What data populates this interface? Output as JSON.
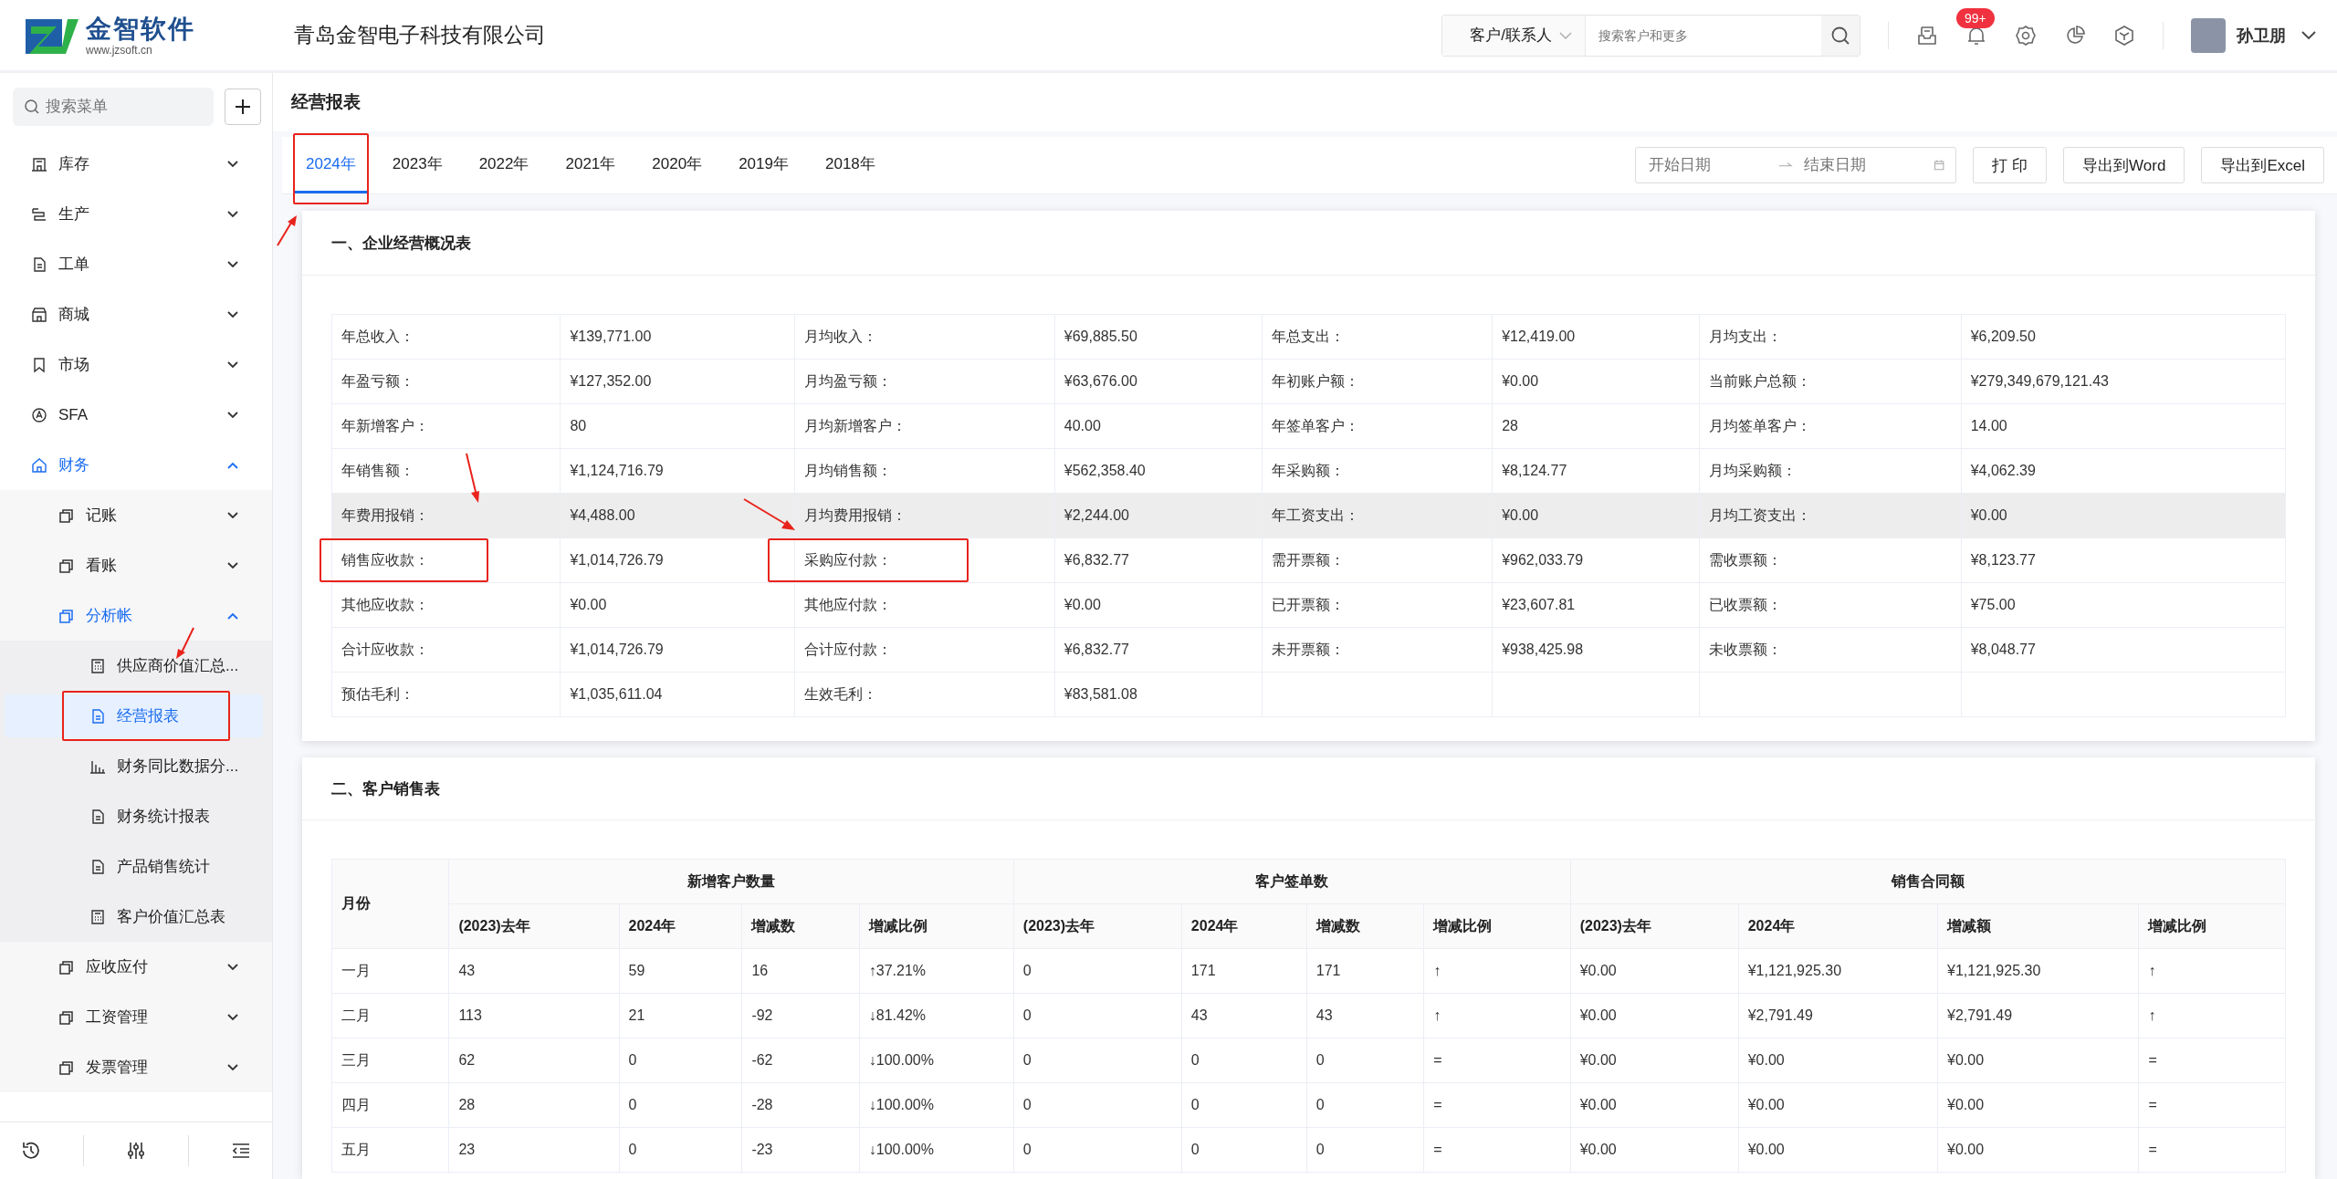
{
  "logo": {
    "name": "金智软件",
    "url": "www.jzsoft.cn"
  },
  "company": "青岛金智电子科技有限公司",
  "header": {
    "search_scope": "客户/联系人",
    "search": {
      "placeholder": "搜索客户和更多"
    },
    "notification_badge": "99+",
    "user": {
      "name": "孙卫朋"
    }
  },
  "sidebar": {
    "search": {
      "placeholder": "搜索菜单"
    },
    "items": [
      {
        "label": "库存",
        "selected": false,
        "expanded": false
      },
      {
        "label": "生产",
        "selected": false,
        "expanded": false
      },
      {
        "label": "工单",
        "selected": false,
        "expanded": false
      },
      {
        "label": "商城",
        "selected": false,
        "expanded": false
      },
      {
        "label": "市场",
        "selected": false,
        "expanded": false
      },
      {
        "label": "SFA",
        "selected": false,
        "expanded": false
      },
      {
        "label": "财务",
        "selected": true,
        "expanded": true,
        "children": [
          {
            "label": "记账",
            "selected": false,
            "expanded": false
          },
          {
            "label": "看账",
            "selected": false,
            "expanded": false
          },
          {
            "label": "分析帐",
            "selected": true,
            "expanded": true,
            "children": [
              {
                "label": "供应商价值汇总...",
                "selected": false,
                "highlighted": false
              },
              {
                "label": "经营报表",
                "selected": true,
                "highlighted": true
              },
              {
                "label": "财务同比数据分...",
                "selected": false,
                "highlighted": false
              },
              {
                "label": "财务统计报表",
                "selected": false,
                "highlighted": false
              },
              {
                "label": "产品销售统计",
                "selected": false,
                "highlighted": false
              },
              {
                "label": "客户价值汇总表",
                "selected": false,
                "highlighted": false
              }
            ]
          },
          {
            "label": "应收应付",
            "selected": false,
            "expanded": false
          },
          {
            "label": "工资管理",
            "selected": false,
            "expanded": false
          },
          {
            "label": "发票管理",
            "selected": false,
            "expanded": false
          }
        ]
      }
    ]
  },
  "page_title": "经营报表",
  "year_tabs": [
    {
      "label": "2024年",
      "selected": true,
      "highlighted": true
    },
    {
      "label": "2023年",
      "selected": false,
      "highlighted": false
    },
    {
      "label": "2022年",
      "selected": false,
      "highlighted": false
    },
    {
      "label": "2021年",
      "selected": false,
      "highlighted": false
    },
    {
      "label": "2020年",
      "selected": false,
      "highlighted": false
    },
    {
      "label": "2019年",
      "selected": false,
      "highlighted": false
    },
    {
      "label": "2018年",
      "selected": false,
      "highlighted": false
    }
  ],
  "date_range": {
    "start_placeholder": "开始日期",
    "end_placeholder": "结束日期"
  },
  "actions": [
    "打 印",
    "导出到Word",
    "导出到Excel"
  ],
  "overview": {
    "title": "一、企业经营概况表",
    "rows": [
      {
        "hovered": false,
        "pairs": [
          {
            "label": "年总收入：",
            "value": "¥139,771.00",
            "highlighted": false
          },
          {
            "label": "月均收入：",
            "value": "¥69,885.50",
            "highlighted": false
          },
          {
            "label": "年总支出：",
            "value": "¥12,419.00",
            "highlighted": false
          },
          {
            "label": "月均支出：",
            "value": "¥6,209.50",
            "highlighted": false
          }
        ]
      },
      {
        "hovered": false,
        "pairs": [
          {
            "label": "年盈亏额：",
            "value": "¥127,352.00",
            "highlighted": false
          },
          {
            "label": "月均盈亏额：",
            "value": "¥63,676.00",
            "highlighted": false
          },
          {
            "label": "年初账户额：",
            "value": "¥0.00",
            "highlighted": false
          },
          {
            "label": "当前账户总额：",
            "value": "¥279,349,679,121.43",
            "highlighted": false
          }
        ]
      },
      {
        "hovered": false,
        "pairs": [
          {
            "label": "年新增客户：",
            "value": "80",
            "highlighted": false
          },
          {
            "label": "月均新增客户：",
            "value": "40.00",
            "highlighted": false
          },
          {
            "label": "年签单客户：",
            "value": "28",
            "highlighted": false
          },
          {
            "label": "月均签单客户：",
            "value": "14.00",
            "highlighted": false
          }
        ]
      },
      {
        "hovered": false,
        "pairs": [
          {
            "label": "年销售额：",
            "value": "¥1,124,716.79",
            "highlighted": false
          },
          {
            "label": "月均销售额：",
            "value": "¥562,358.40",
            "highlighted": false
          },
          {
            "label": "年采购额：",
            "value": "¥8,124.77",
            "highlighted": false
          },
          {
            "label": "月均采购额：",
            "value": "¥4,062.39",
            "highlighted": false
          }
        ]
      },
      {
        "hovered": true,
        "pairs": [
          {
            "label": "年费用报销：",
            "value": "¥4,488.00",
            "highlighted": false
          },
          {
            "label": "月均费用报销：",
            "value": "¥2,244.00",
            "highlighted": false
          },
          {
            "label": "年工资支出：",
            "value": "¥0.00",
            "highlighted": false
          },
          {
            "label": "月均工资支出：",
            "value": "¥0.00",
            "highlighted": false
          }
        ]
      },
      {
        "hovered": false,
        "pairs": [
          {
            "label": "销售应收款：",
            "value": "¥1,014,726.79",
            "highlighted": true
          },
          {
            "label": "采购应付款：",
            "value": "¥6,832.77",
            "highlighted": true
          },
          {
            "label": "需开票额：",
            "value": "¥962,033.79",
            "highlighted": false
          },
          {
            "label": "需收票额：",
            "value": "¥8,123.77",
            "highlighted": false
          }
        ]
      },
      {
        "hovered": false,
        "pairs": [
          {
            "label": "其他应收款：",
            "value": "¥0.00",
            "highlighted": false
          },
          {
            "label": "其他应付款：",
            "value": "¥0.00",
            "highlighted": false
          },
          {
            "label": "已开票额：",
            "value": "¥23,607.81",
            "highlighted": false
          },
          {
            "label": "已收票额：",
            "value": "¥75.00",
            "highlighted": false
          }
        ]
      },
      {
        "hovered": false,
        "pairs": [
          {
            "label": "合计应收款：",
            "value": "¥1,014,726.79",
            "highlighted": false
          },
          {
            "label": "合计应付款：",
            "value": "¥6,832.77",
            "highlighted": false
          },
          {
            "label": "未开票额：",
            "value": "¥938,425.98",
            "highlighted": false
          },
          {
            "label": "未收票额：",
            "value": "¥8,048.77",
            "highlighted": false
          }
        ]
      },
      {
        "hovered": false,
        "pairs": [
          {
            "label": "预估毛利：",
            "value": "¥1,035,611.04",
            "highlighted": false
          },
          {
            "label": "生效毛利：",
            "value": "¥83,581.08",
            "highlighted": false
          }
        ]
      }
    ]
  },
  "customer_sales": {
    "title": "二、客户销售表",
    "month_column": "月份",
    "groups": [
      {
        "title": "新增客户数量",
        "columns": [
          "(2023)去年",
          "2024年",
          "增减数",
          "增减比例"
        ]
      },
      {
        "title": "客户签单数",
        "columns": [
          "(2023)去年",
          "2024年",
          "增减数",
          "增减比例"
        ]
      },
      {
        "title": "销售合同额",
        "columns": [
          "(2023)去年",
          "2024年",
          "增减额",
          "增减比例"
        ]
      }
    ],
    "rows": [
      [
        "一月",
        "43",
        "59",
        "16",
        "↑37.21%",
        "0",
        "171",
        "171",
        "↑",
        "¥0.00",
        "¥1,121,925.30",
        "¥1,121,925.30",
        "↑"
      ],
      [
        "二月",
        "113",
        "21",
        "-92",
        "↓81.42%",
        "0",
        "43",
        "43",
        "↑",
        "¥0.00",
        "¥2,791.49",
        "¥2,791.49",
        "↑"
      ],
      [
        "三月",
        "62",
        "0",
        "-62",
        "↓100.00%",
        "0",
        "0",
        "0",
        "=",
        "¥0.00",
        "¥0.00",
        "¥0.00",
        "="
      ],
      [
        "四月",
        "28",
        "0",
        "-28",
        "↓100.00%",
        "0",
        "0",
        "0",
        "=",
        "¥0.00",
        "¥0.00",
        "¥0.00",
        "="
      ],
      [
        "五月",
        "23",
        "0",
        "-23",
        "↓100.00%",
        "0",
        "0",
        "0",
        "=",
        "¥0.00",
        "¥0.00",
        "¥0.00",
        "="
      ]
    ]
  }
}
